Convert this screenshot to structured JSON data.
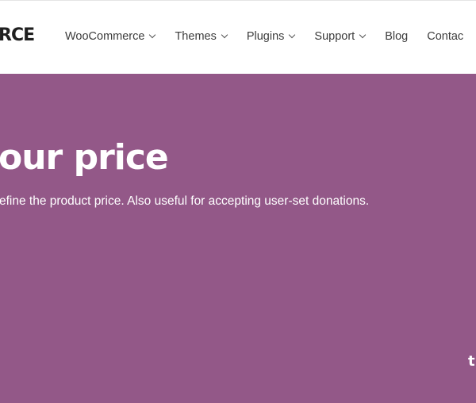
{
  "header": {
    "logo_text": "RCE",
    "nav": [
      {
        "label": "WooCommerce",
        "has_dropdown": true
      },
      {
        "label": "Themes",
        "has_dropdown": true
      },
      {
        "label": "Plugins",
        "has_dropdown": true
      },
      {
        "label": "Support",
        "has_dropdown": true
      },
      {
        "label": "Blog",
        "has_dropdown": false
      },
      {
        "label": "Contac",
        "has_dropdown": false
      }
    ]
  },
  "hero": {
    "title": "our price",
    "description": "efine the product price. Also useful for accepting user-set donations.",
    "corner_text": "t",
    "background_color": "#935888"
  }
}
